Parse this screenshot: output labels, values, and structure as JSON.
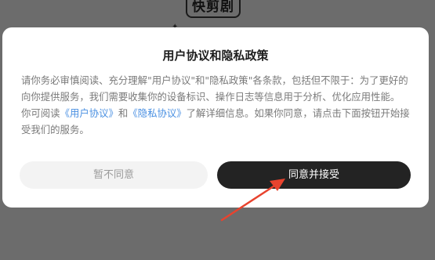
{
  "app": {
    "logo_text": "快剪剧",
    "star_glyph": "✦"
  },
  "dialog": {
    "title": "用户协议和隐私政策",
    "paragraph1": "请你务必审慎阅读、充分理解\"用户协议\"和\"隐私政策\"各条款，包括但不限于：为了更好的向你提供服务，我们需要收集你的设备标识、操作日志等信息用于分析、优化应用性能。",
    "paragraph2_prefix": "你可阅读",
    "user_agreement_link": "《用户协议》",
    "paragraph2_and": "和",
    "privacy_policy_link": "《隐私协议》",
    "paragraph2_suffix": "了解详细信息。如果你同意，请点击下面按钮开始接受我们的服务。",
    "decline_label": "暂不同意",
    "accept_label": "同意并接受"
  },
  "colors": {
    "backdrop": "#6c6c6c",
    "dialog_bg": "#ffffff",
    "link": "#4a90e2",
    "accept_bg": "#232323",
    "decline_bg": "#f3f3f3",
    "arrow": "#e8432e"
  },
  "annotation": {
    "arrow_icon": "red-arrow-icon"
  }
}
